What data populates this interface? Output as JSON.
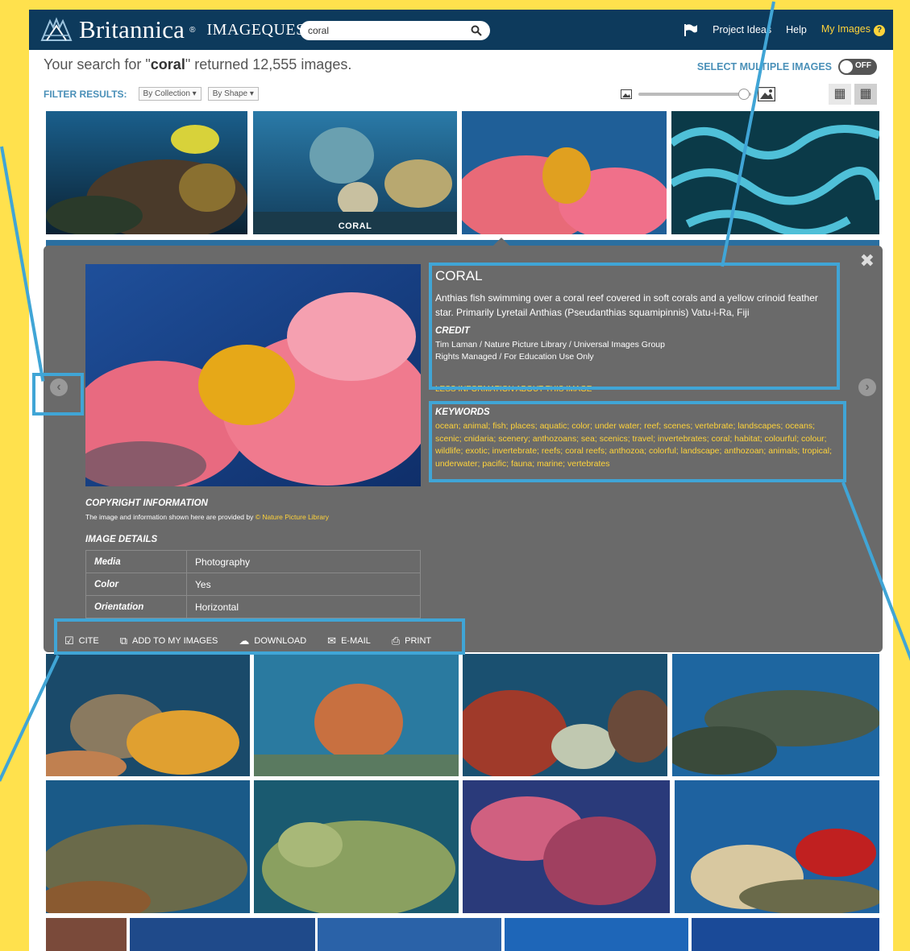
{
  "header": {
    "brand": "Britannica",
    "product": "IMAGEQUEST",
    "search_value": "coral",
    "nav": [
      "Project Ideas",
      "Help",
      "My Images"
    ]
  },
  "results": {
    "prefix": "Your search for \"",
    "term": "coral",
    "suffix": "\" returned 12,555 images.",
    "select_multiple": "SELECT MULTIPLE IMAGES",
    "toggle": "OFF",
    "filter_label": "FILTER RESULTS:",
    "filters": [
      "By Collection ▾",
      "By Shape ▾"
    ]
  },
  "grid_captions": {
    "tile_2": "CORAL"
  },
  "detail": {
    "title": "CORAL",
    "description": "Anthias fish swimming over a coral reef covered in soft corals and a yellow crinoid feather star. Primarily Lyretail Anthias (Pseudanthias squamipinnis) Vatu-i-Ra, Fiji",
    "credit_heading": "CREDIT",
    "credit_line1": "Tim Laman / Nature Picture Library / Universal Images Group",
    "credit_line2": "Rights Managed / For Education Use Only",
    "less_info": "LESS INFORMATION ABOUT THIS IMAGE",
    "keywords_heading": "KEYWORDS",
    "keywords": "ocean; animal; fish; places; aquatic; color; under water; reef; scenes; vertebrate; landscapes; oceans; scenic; cnidaria; scenery; anthozoans; sea; scenics; travel; invertebrates; coral; habitat; colourful; colour; wildlife; exotic; invertebrate; reefs; coral reefs; anthozoa; colorful; landscape; anthozoan; animals; tropical; underwater; pacific; fauna; marine; vertebrates",
    "copyright_heading": "COPYRIGHT INFORMATION",
    "copyright_text": "The image and information shown here are provided by",
    "copyright_link": "© Nature Picture Library",
    "details_heading": "IMAGE DETAILS",
    "details": [
      {
        "k": "Media",
        "v": "Photography"
      },
      {
        "k": "Color",
        "v": "Yes"
      },
      {
        "k": "Orientation",
        "v": "Horizontal"
      }
    ],
    "actions": [
      "CITE",
      "ADD TO MY IMAGES",
      "DOWNLOAD",
      "E-MAIL",
      "PRINT"
    ],
    "close": "✖",
    "prev": "‹",
    "next": "›"
  },
  "colors": {
    "frame": "#ffe14d",
    "header": "#0d3a5c",
    "accent": "#40a5d6",
    "link": "#ffd33a",
    "overlay": "#6a6a6a"
  }
}
